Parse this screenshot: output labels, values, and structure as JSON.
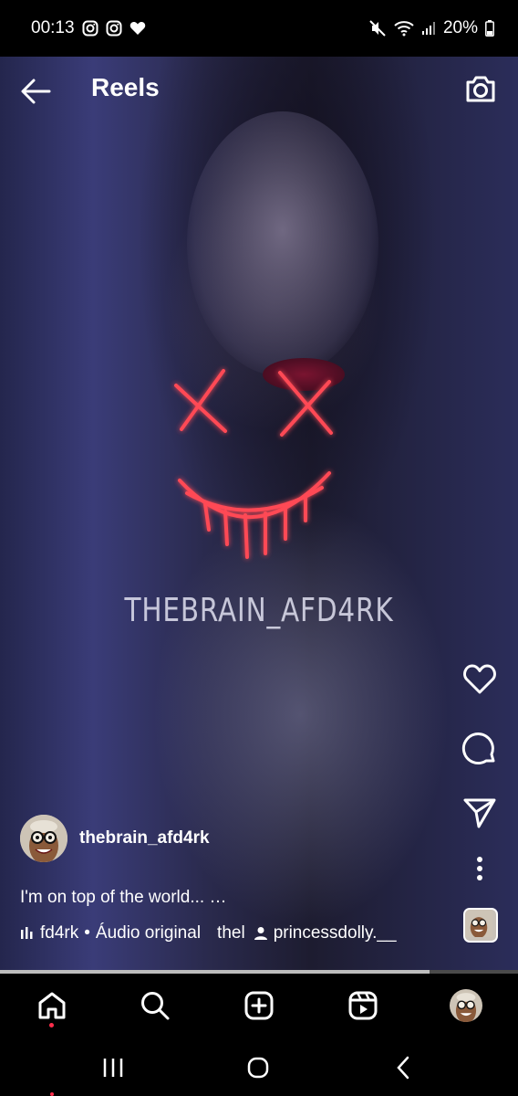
{
  "status_bar": {
    "time": "00:13",
    "battery": "20%",
    "left_icons": [
      "instagram-icon",
      "instagram-icon",
      "heart-icon"
    ],
    "right_icons": [
      "mute-icon",
      "wifi-icon",
      "signal-icon",
      "battery-icon"
    ]
  },
  "header": {
    "title": "Reels",
    "back_icon": "arrow-left-icon",
    "camera_icon": "camera-icon"
  },
  "video": {
    "watermark": "THEBRAIN_AFD4RK"
  },
  "actions": [
    {
      "name": "like",
      "icon": "heart-icon"
    },
    {
      "name": "comment",
      "icon": "comment-icon"
    },
    {
      "name": "share",
      "icon": "send-icon"
    },
    {
      "name": "more",
      "icon": "more-vertical-icon"
    }
  ],
  "post": {
    "username": "thebrain_afd4rk",
    "caption": "I'm on top of the world... …",
    "audio_author": "fd4rk",
    "audio_separator": "•",
    "audio_label": "Áudio original",
    "audio_extra": "thel",
    "tagged_user": "princessdolly.__"
  },
  "progress": 0.83,
  "bottom_nav": [
    "home-icon",
    "search-icon",
    "add-post-icon",
    "reels-icon",
    "profile-avatar"
  ],
  "colors": {
    "accent_dot": "#ff2e4c",
    "neon": "#ff4a55"
  }
}
